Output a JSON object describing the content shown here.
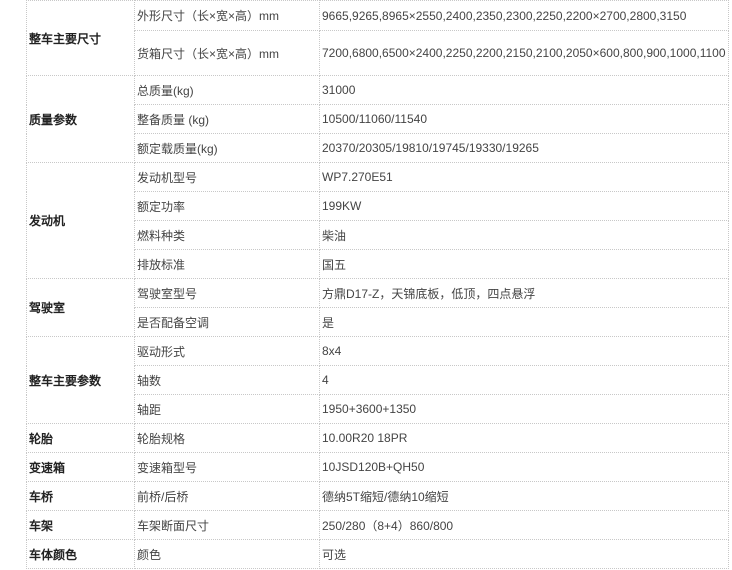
{
  "spec_table": {
    "groups": [
      {
        "category": "整车主要尺寸",
        "rows": [
          {
            "label": "外形尺寸（长×宽×高）mm",
            "value": "9665,9265,8965×2550,2400,2350,2300,2250,2200×2700,2800,3150",
            "h": 30
          },
          {
            "label": "货箱尺寸（长×宽×高）mm",
            "value": "7200,6800,6500×2400,2250,2200,2150,2100,2050×600,800,900,1000,1100",
            "h": 45
          }
        ]
      },
      {
        "category": "质量参数",
        "rows": [
          {
            "label": "总质量(kg)",
            "value": "31000",
            "h": 29
          },
          {
            "label": "整备质量 (kg)",
            "value": "10500/11060/11540",
            "h": 29
          },
          {
            "label": "额定载质量(kg)",
            "value": "20370/20305/19810/19745/19330/19265",
            "h": 29
          }
        ]
      },
      {
        "category": "发动机",
        "rows": [
          {
            "label": "发动机型号",
            "value": "WP7.270E51",
            "h": 29
          },
          {
            "label": "额定功率",
            "value": "199KW",
            "h": 29
          },
          {
            "label": "燃料种类",
            "value": "柴油",
            "h": 29
          },
          {
            "label": "排放标准",
            "value": "国五",
            "h": 29
          }
        ]
      },
      {
        "category": "驾驶室",
        "rows": [
          {
            "label": "驾驶室型号",
            "value": "方鼎D17-Z，天锦底板，低顶，四点悬浮",
            "h": 29
          },
          {
            "label": "是否配备空调",
            "value": "是",
            "h": 29
          }
        ]
      },
      {
        "category": "整车主要参数",
        "rows": [
          {
            "label": "驱动形式",
            "value": "8x4",
            "h": 29
          },
          {
            "label": "轴数",
            "value": "4",
            "h": 29
          },
          {
            "label": "轴距",
            "value": "1950+3600+1350",
            "h": 29
          }
        ]
      },
      {
        "category": "轮胎",
        "rows": [
          {
            "label": "轮胎规格",
            "value": "10.00R20 18PR",
            "h": 29
          }
        ]
      },
      {
        "category": "变速箱",
        "rows": [
          {
            "label": "变速箱型号",
            "value": "10JSD120B+QH50",
            "h": 29
          }
        ]
      },
      {
        "category": "车桥",
        "rows": [
          {
            "label": "前桥/后桥",
            "value": "德纳5T缩短/德纳10缩短",
            "h": 29
          }
        ]
      },
      {
        "category": "车架",
        "rows": [
          {
            "label": "车架断面尺寸",
            "value": "250/280（8+4）860/800",
            "h": 29
          }
        ]
      },
      {
        "category": "车体颜色",
        "rows": [
          {
            "label": "颜色",
            "value": "可选",
            "h": 29
          }
        ]
      }
    ]
  }
}
